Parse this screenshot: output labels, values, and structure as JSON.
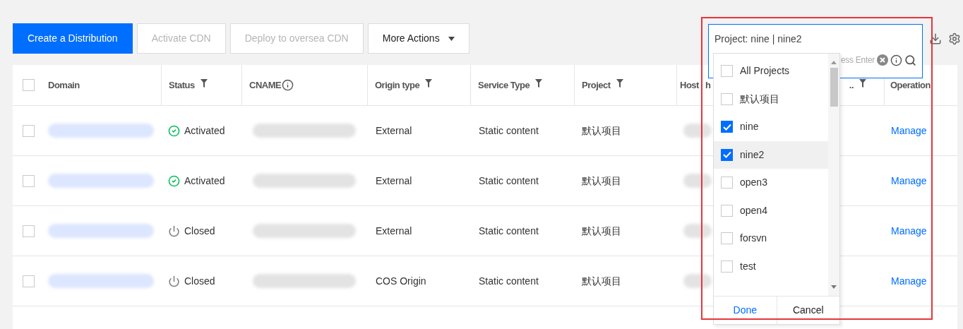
{
  "toolbar": {
    "buttons": [
      {
        "label": "Create a Distribution",
        "kind": "primary",
        "disabled": false
      },
      {
        "label": "Activate CDN",
        "kind": "default",
        "disabled": true
      },
      {
        "label": "Deploy to oversea CDN",
        "kind": "default",
        "disabled": true
      },
      {
        "label": "More Actions",
        "kind": "dropdown",
        "disabled": false
      }
    ]
  },
  "search": {
    "value": "Project: nine | nine2",
    "hint": "ess Enter"
  },
  "table": {
    "select_all": {
      "checked": false
    },
    "columns": [
      {
        "label": "Domain",
        "filter": false,
        "info": false
      },
      {
        "label": "Status",
        "filter": true,
        "info": false
      },
      {
        "label": "CNAME",
        "filter": false,
        "info": true
      },
      {
        "label": "Origin type",
        "filter": true,
        "info": false
      },
      {
        "label": "Service Type",
        "filter": true,
        "info": false
      },
      {
        "label": "Project",
        "filter": true,
        "info": false
      },
      {
        "label": "Host h",
        "filter": false,
        "info": false
      },
      {
        "label": "..",
        "filter": true,
        "info": false
      },
      {
        "label": "Operation",
        "filter": false,
        "info": false
      }
    ],
    "rows": [
      {
        "checked": false,
        "status": {
          "kind": "activated",
          "label": "Activated"
        },
        "origin_type": "External",
        "service_type": "Static content",
        "project": "默认项目",
        "action": "Manage"
      },
      {
        "checked": false,
        "status": {
          "kind": "activated",
          "label": "Activated"
        },
        "origin_type": "External",
        "service_type": "Static content",
        "project": "默认项目",
        "action": "Manage"
      },
      {
        "checked": false,
        "status": {
          "kind": "closed",
          "label": "Closed"
        },
        "origin_type": "External",
        "service_type": "Static content",
        "project": "默认项目",
        "action": "Manage"
      },
      {
        "checked": false,
        "status": {
          "kind": "closed",
          "label": "Closed"
        },
        "origin_type": "COS Origin",
        "service_type": "Static content",
        "project": "默认项目",
        "action": "Manage"
      }
    ]
  },
  "project_filter": {
    "options": [
      {
        "label": "All Projects",
        "checked": false,
        "highlighted": false
      },
      {
        "label": "默认项目",
        "checked": false,
        "highlighted": false
      },
      {
        "label": "nine",
        "checked": true,
        "highlighted": false
      },
      {
        "label": "nine2",
        "checked": true,
        "highlighted": true
      },
      {
        "label": "open3",
        "checked": false,
        "highlighted": false
      },
      {
        "label": "open4",
        "checked": false,
        "highlighted": false
      },
      {
        "label": "forsvn",
        "checked": false,
        "highlighted": false
      },
      {
        "label": "test",
        "checked": false,
        "highlighted": false
      }
    ],
    "buttons": [
      {
        "label": "Done",
        "kind": "primary"
      },
      {
        "label": "Cancel",
        "kind": "default"
      }
    ]
  }
}
